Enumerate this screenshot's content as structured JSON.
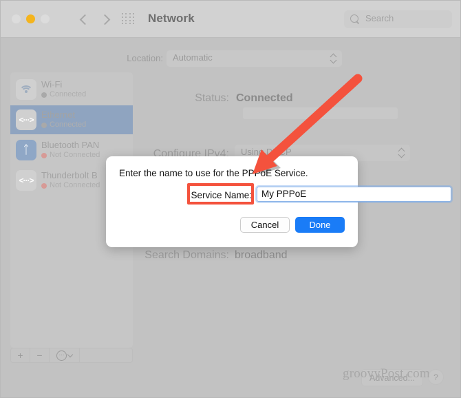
{
  "window": {
    "title": "Network",
    "traffic_lights": [
      "close-red",
      "minimize-amber",
      "zoom-green"
    ],
    "back_label": "Back",
    "forward_label": "Forward",
    "grid_label": "Show All",
    "search_placeholder": "Search"
  },
  "location_row": {
    "label": "Location:",
    "value": "Automatic"
  },
  "sidebar": {
    "items": [
      {
        "name": "Wi-Fi",
        "status": "Connected",
        "icon": "wifi-icon",
        "state": "connected"
      },
      {
        "name": "Ethernet",
        "status": "Connected",
        "icon": "ethernet-icon",
        "state": "connected",
        "selected": true
      },
      {
        "name": "Bluetooth PAN",
        "status": "Not Connected",
        "icon": "bluetooth-icon",
        "state": "disconnected"
      },
      {
        "name": "Thunderbolt B",
        "status": "Not Connected",
        "icon": "ethernet-icon",
        "state": "disconnected"
      }
    ],
    "tools": {
      "add": "+",
      "remove": "−",
      "actions": "⋯",
      "chevron": "chevron-down-icon"
    }
  },
  "detail": {
    "status_label": "Status:",
    "status_value": "Connected",
    "configure_label": "Configure IPv4:",
    "configure_value": "Using DHCP",
    "search_domains_label": "Search Domains:",
    "search_domains_value": "broadband",
    "advanced_label": "Advanced...",
    "help_label": "?"
  },
  "sheet": {
    "title": "Enter the name to use for the PPPoE Service.",
    "field_label": "Service Name:",
    "field_value": "My PPPoE",
    "cancel_label": "Cancel",
    "done_label": "Done"
  },
  "annotation": {
    "arrow_color": "#f4523d",
    "highlight_color": "#f4523d"
  },
  "watermark": {
    "text": "groovyPost.com"
  }
}
